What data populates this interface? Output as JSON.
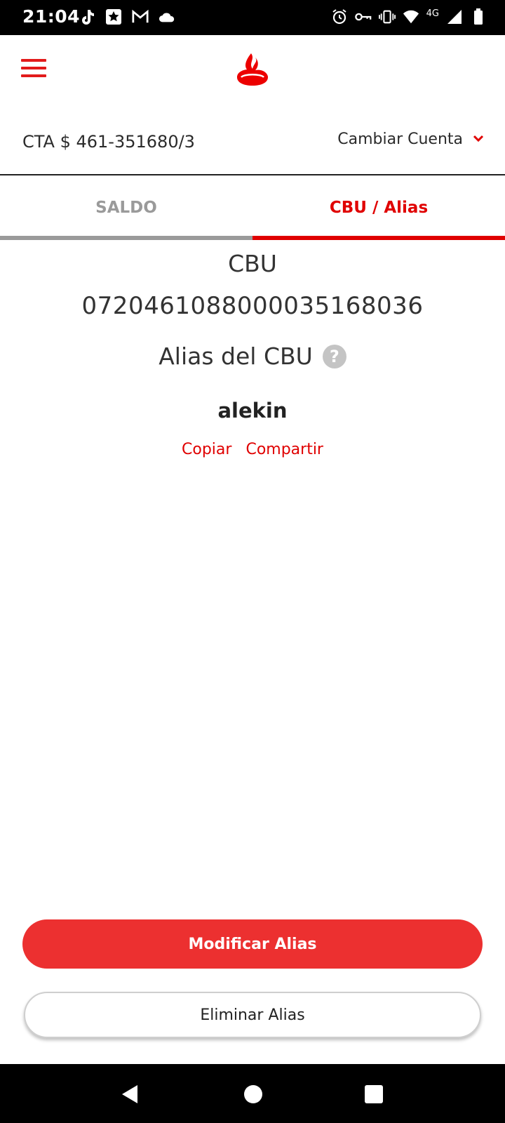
{
  "status_bar": {
    "time": "21:04",
    "network": "4G",
    "left_icons": [
      "tiktok-icon",
      "star-app-icon",
      "gmail-icon",
      "cloud-icon"
    ],
    "right_icons": [
      "alarm-icon",
      "vpn-key-icon",
      "vibrate-icon",
      "wifi-icon",
      "signal-icon",
      "battery-icon"
    ]
  },
  "header": {
    "menu_icon": "hamburger-icon",
    "logo": "santander-flame-logo"
  },
  "account": {
    "label": "CTA $ 461-351680/3",
    "change_label": "Cambiar Cuenta"
  },
  "tabs": [
    {
      "label": "SALDO",
      "active": false
    },
    {
      "label": "CBU / Alias",
      "active": true
    }
  ],
  "cbu": {
    "title": "CBU",
    "number": "0720461088000035168036",
    "alias_title": "Alias del CBU",
    "help_glyph": "?",
    "alias_value": "alekin",
    "copy_label": "Copiar",
    "share_label": "Compartir"
  },
  "buttons": {
    "modify": "Modificar Alias",
    "delete": "Eliminar Alias"
  },
  "colors": {
    "brand_red": "#ec0000",
    "primary_button": "#ec3030",
    "inactive_tab": "#9a9a9a"
  }
}
